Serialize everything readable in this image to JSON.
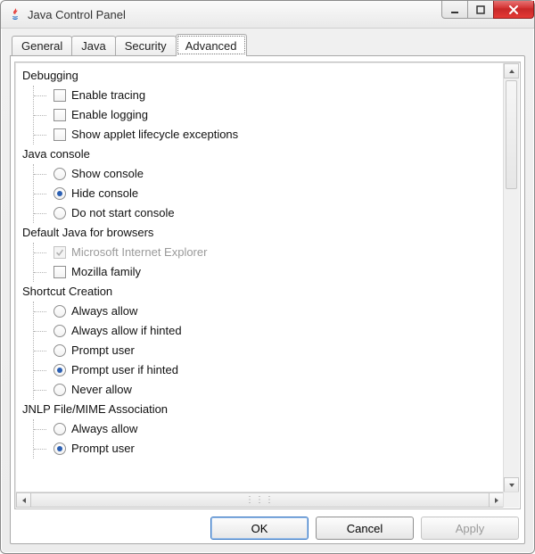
{
  "window": {
    "title": "Java Control Panel"
  },
  "tabs": [
    {
      "label": "General"
    },
    {
      "label": "Java"
    },
    {
      "label": "Security"
    },
    {
      "label": "Advanced",
      "active": true
    }
  ],
  "tree": {
    "debugging": {
      "label": "Debugging",
      "items": [
        {
          "label": "Enable tracing",
          "kind": "checkbox",
          "checked": false
        },
        {
          "label": "Enable logging",
          "kind": "checkbox",
          "checked": false
        },
        {
          "label": "Show applet lifecycle exceptions",
          "kind": "checkbox",
          "checked": false
        }
      ]
    },
    "java_console": {
      "label": "Java console",
      "items": [
        {
          "label": "Show console",
          "kind": "radio",
          "checked": false
        },
        {
          "label": "Hide console",
          "kind": "radio",
          "checked": true
        },
        {
          "label": "Do not start console",
          "kind": "radio",
          "checked": false
        }
      ]
    },
    "default_java_browsers": {
      "label": "Default Java for browsers",
      "items": [
        {
          "label": "Microsoft Internet Explorer",
          "kind": "checkbox",
          "checked": true,
          "disabled": true
        },
        {
          "label": "Mozilla family",
          "kind": "checkbox",
          "checked": false
        }
      ]
    },
    "shortcut_creation": {
      "label": "Shortcut Creation",
      "items": [
        {
          "label": "Always allow",
          "kind": "radio",
          "checked": false
        },
        {
          "label": "Always allow if hinted",
          "kind": "radio",
          "checked": false
        },
        {
          "label": "Prompt user",
          "kind": "radio",
          "checked": false
        },
        {
          "label": "Prompt user if hinted",
          "kind": "radio",
          "checked": true
        },
        {
          "label": "Never allow",
          "kind": "radio",
          "checked": false
        }
      ]
    },
    "jnlp_assoc": {
      "label": "JNLP File/MIME Association",
      "items": [
        {
          "label": "Always allow",
          "kind": "radio",
          "checked": false
        },
        {
          "label": "Prompt user",
          "kind": "radio",
          "checked": true
        }
      ]
    }
  },
  "buttons": {
    "ok": "OK",
    "cancel": "Cancel",
    "apply": "Apply"
  }
}
